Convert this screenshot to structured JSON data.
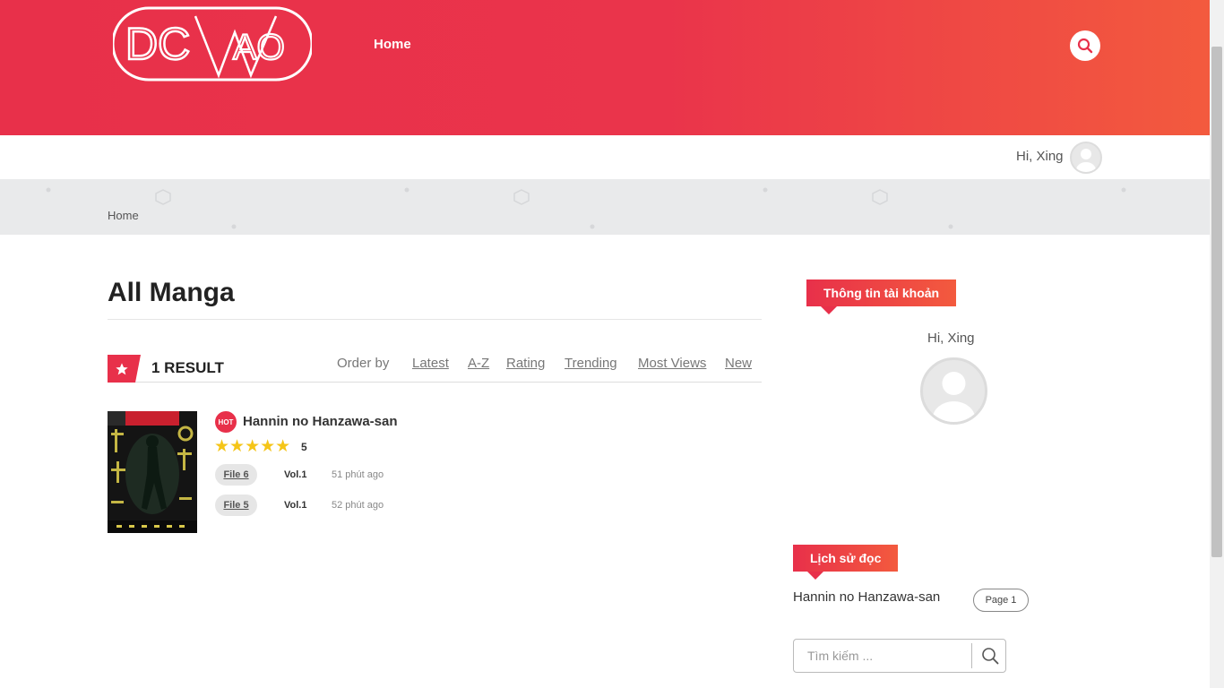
{
  "colors": {
    "accent": "#e8304a",
    "accent_end": "#f35a3e",
    "star": "#f5c518"
  },
  "header": {
    "logo_text": "DCWAO",
    "nav": [
      {
        "label": "Home"
      }
    ],
    "search_icon": "search-icon"
  },
  "userbar": {
    "greeting": "Hi, Xing",
    "avatar_icon": "user-avatar-icon"
  },
  "breadcrumb": {
    "items": [
      "Home"
    ]
  },
  "main": {
    "title": "All Manga",
    "results": {
      "count_label": "1 RESULT",
      "icon": "star-icon"
    },
    "order": {
      "label": "Order by",
      "options": [
        "Latest",
        "A-Z",
        "Rating",
        "Trending",
        "Most Views",
        "New"
      ]
    },
    "items": [
      {
        "badge": "HOT",
        "title": "Hannin no Hanzawa-san",
        "rating": 5,
        "rating_label": "5",
        "stars": "★★★★★",
        "chapters": [
          {
            "file": "File 6",
            "vol": "Vol.1",
            "time": "51 phút ago"
          },
          {
            "file": "File 5",
            "vol": "Vol.1",
            "time": "52 phút ago"
          }
        ]
      }
    ]
  },
  "sidebar": {
    "account": {
      "label": "Thông tin tài khoản",
      "greeting": "Hi, Xing"
    },
    "history": {
      "label": "Lịch sử đọc",
      "items": [
        {
          "title": "Hannin no Hanzawa-san",
          "page": "Page 1"
        }
      ]
    },
    "search": {
      "placeholder": "Tìm kiếm ..."
    }
  }
}
